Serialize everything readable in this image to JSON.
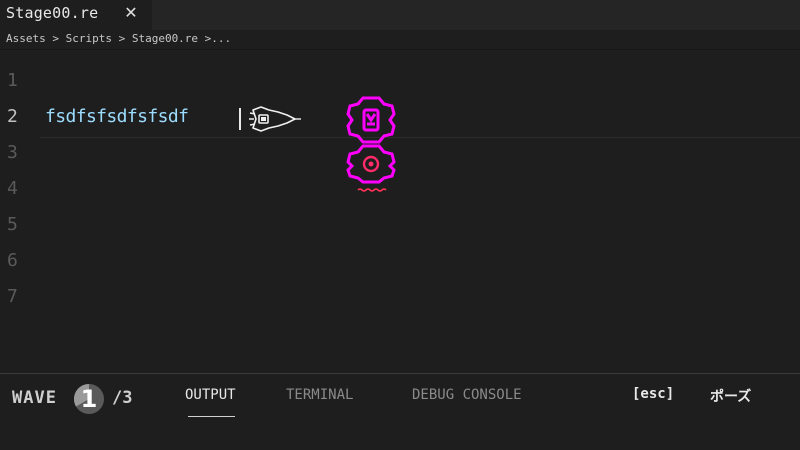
{
  "tab": {
    "title": "Stage00.re",
    "close_glyph": "✕"
  },
  "breadcrumb": "Assets > Scripts > Stage00.re >...",
  "editor": {
    "line_numbers": [
      "1",
      "2",
      "3",
      "4",
      "5",
      "6",
      "7"
    ],
    "current_line": "fsdfsfsdfsfsdf"
  },
  "panel": {
    "wave_label": "WAVE",
    "wave_current": "1",
    "wave_total": "/3",
    "tabs": [
      {
        "label": "OUTPUT"
      },
      {
        "label": "TERMINAL"
      },
      {
        "label": "DEBUG CONSOLE"
      }
    ],
    "active_tab": "OUTPUT",
    "esc_hint": "[esc]",
    "pause_hint": "ポーズ"
  },
  "colors": {
    "background": "#1e1e1e",
    "code_text": "#9cdcfe",
    "enemy": "#ff00ff",
    "enemy_core": "#ff2a6a"
  },
  "icons": {
    "ship": "rocket-ship-icon",
    "enemy": "gear-enemy-icon"
  }
}
